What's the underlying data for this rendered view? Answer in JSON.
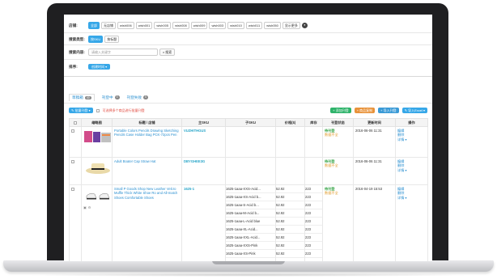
{
  "filters": {
    "store_label": "店铺:",
    "stores": [
      "全部",
      "无店铺",
      "wish006",
      "wish001",
      "wish005",
      "wish008",
      "wish009",
      "wish003",
      "wish010",
      "wish011",
      "wish050",
      "显示更多"
    ],
    "type_label": "搜索类型:",
    "types": [
      "按SKU",
      "按标题"
    ],
    "content_label": "搜索内容:",
    "search_placeholder": "请输入关键字",
    "search_button": "搜索",
    "sort_label": "排序:",
    "sort_value": "创建时间"
  },
  "tabs": [
    {
      "label": "草稿箱",
      "count": "40"
    },
    {
      "label": "刊登中",
      "count": "0"
    },
    {
      "label": "刊登失败",
      "count": "0"
    }
  ],
  "toolbar": {
    "batch": "批量刊登",
    "hint": "可选择多个商品进行批量刊登",
    "add": "添加刊登",
    "copy": "商品复制",
    "export": "导入刊登",
    "import": "导入Excel"
  },
  "columns": [
    "",
    "缩略图",
    "标题 / 店铺",
    "主SKU",
    "子SKU",
    "价格($)",
    "库存",
    "刊登状态",
    "更新时间",
    "操作"
  ],
  "rows": [
    {
      "title": "Portable Colors Pencils Drawing Sketching Pencils Case Holder Bag PCK-72pcs Pen",
      "sku": "VUZHITHGUS",
      "status": "待刊登",
      "status2": "数据不全",
      "time": "2016-06-06 11:31",
      "sub": []
    },
    {
      "title": "Adult Boater Cap Straw Hat",
      "sku": "DBYGHEE3G",
      "status": "待刊登",
      "status2": "数据不全",
      "time": "2016-06-06 11:31",
      "sub": []
    },
    {
      "title": "Small P Goods Shop New Leather Velcro Muffle Thick White Shoe Ro and All-match Shoes Comfortable Shoes",
      "sku": "1625-1",
      "status": "待刊登",
      "status2": "数据不全",
      "time": "2016-04-19 15:53",
      "sub": [
        {
          "s": "1625-1aaa-XXS-Acid...",
          "p": "52.92",
          "q": "223"
        },
        {
          "s": "1625-1aaa-XS-Acid b...",
          "p": "52.92",
          "q": "223"
        },
        {
          "s": "1625-1aaa-S-Acid b...",
          "p": "52.92",
          "q": "223"
        },
        {
          "s": "1625-1aaa-M-Acid b...",
          "p": "52.92",
          "q": "223"
        },
        {
          "s": "1625-1aaa-L-Acid blue",
          "p": "52.92",
          "q": "223"
        },
        {
          "s": "1625-1aaa-XL-Acid...",
          "p": "52.92",
          "q": "223"
        },
        {
          "s": "1625-1aaa-XXL-Acid...",
          "p": "52.92",
          "q": "223"
        },
        {
          "s": "1625-1aaa-XXS-Pink",
          "p": "52.92",
          "q": "223"
        },
        {
          "s": "1625-1aaa-XS-Pink",
          "p": "52.92",
          "q": "223"
        }
      ]
    }
  ],
  "actions": {
    "edit": "编辑",
    "del": "删除",
    "more": "详情"
  },
  "colors": {
    "accent": "#36a7e8",
    "sku": "#2aa6c9",
    "ok": "#3aa64a",
    "warn": "#e09a2a"
  }
}
